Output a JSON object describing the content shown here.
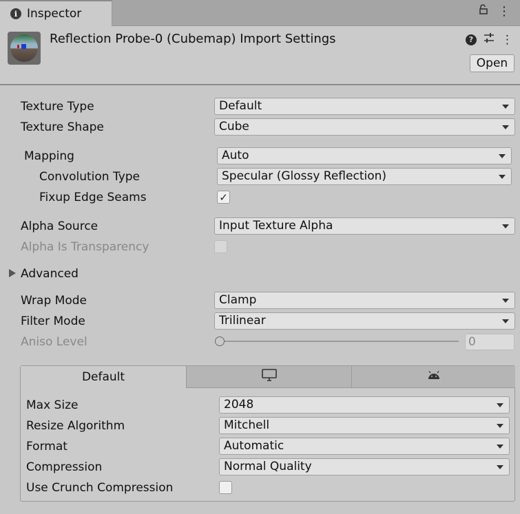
{
  "tab": {
    "title": "Inspector"
  },
  "header": {
    "title": "Reflection Probe-0 (Cubemap) Import Settings",
    "open_label": "Open"
  },
  "fields": {
    "texture_type": {
      "label": "Texture Type",
      "value": "Default"
    },
    "texture_shape": {
      "label": "Texture Shape",
      "value": "Cube"
    },
    "mapping": {
      "label": "Mapping",
      "value": "Auto"
    },
    "convolution_type": {
      "label": "Convolution Type",
      "value": "Specular (Glossy Reflection)"
    },
    "fixup_edge_seams": {
      "label": "Fixup Edge Seams",
      "checked": "✓"
    },
    "alpha_source": {
      "label": "Alpha Source",
      "value": "Input Texture Alpha"
    },
    "alpha_is_transparency": {
      "label": "Alpha Is Transparency"
    },
    "advanced": {
      "label": "Advanced"
    },
    "wrap_mode": {
      "label": "Wrap Mode",
      "value": "Clamp"
    },
    "filter_mode": {
      "label": "Filter Mode",
      "value": "Trilinear"
    },
    "aniso_level": {
      "label": "Aniso Level",
      "value": "0"
    }
  },
  "platform": {
    "tabs": [
      {
        "label": "Default"
      },
      {
        "icon": "monitor-icon"
      },
      {
        "icon": "android-icon"
      }
    ],
    "max_size": {
      "label": "Max Size",
      "value": "2048"
    },
    "resize_algorithm": {
      "label": "Resize Algorithm",
      "value": "Mitchell"
    },
    "format": {
      "label": "Format",
      "value": "Automatic"
    },
    "compression": {
      "label": "Compression",
      "value": "Normal Quality"
    },
    "use_crunch": {
      "label": "Use Crunch Compression"
    }
  }
}
